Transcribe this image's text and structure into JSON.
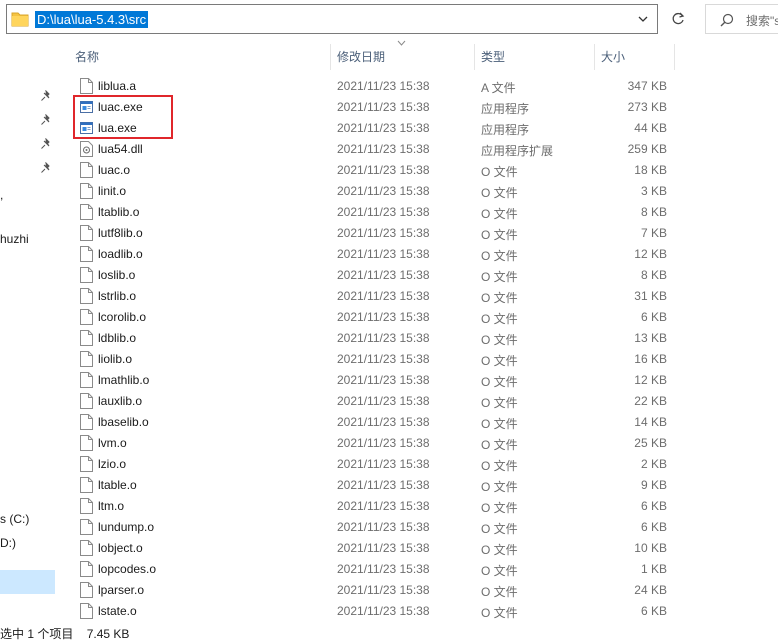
{
  "address": {
    "path": "D:\\lua\\lua-5.4.3\\src"
  },
  "search": {
    "placeholder": "搜索\"s"
  },
  "nav": {
    "items": [
      {
        "label": "huzhi",
        "pinned": false
      },
      {
        "label": "s (C:)",
        "pinned": false
      },
      {
        "label": "D:)",
        "pinned": false,
        "selected": true
      }
    ]
  },
  "columns": {
    "name": "名称",
    "date": "修改日期",
    "type": "类型",
    "size": "大小"
  },
  "files": [
    {
      "name": "liblua.a",
      "date": "2021/11/23 15:38",
      "type": "A 文件",
      "size": "347 KB",
      "icon": "file-icon"
    },
    {
      "name": "luac.exe",
      "date": "2021/11/23 15:38",
      "type": "应用程序",
      "size": "273 KB",
      "icon": "exe-icon"
    },
    {
      "name": "lua.exe",
      "date": "2021/11/23 15:38",
      "type": "应用程序",
      "size": "44 KB",
      "icon": "exe-icon"
    },
    {
      "name": "lua54.dll",
      "date": "2021/11/23 15:38",
      "type": "应用程序扩展",
      "size": "259 KB",
      "icon": "dll-icon"
    },
    {
      "name": "luac.o",
      "date": "2021/11/23 15:38",
      "type": "O 文件",
      "size": "18 KB",
      "icon": "file-icon"
    },
    {
      "name": "linit.o",
      "date": "2021/11/23 15:38",
      "type": "O 文件",
      "size": "3 KB",
      "icon": "file-icon"
    },
    {
      "name": "ltablib.o",
      "date": "2021/11/23 15:38",
      "type": "O 文件",
      "size": "8 KB",
      "icon": "file-icon"
    },
    {
      "name": "lutf8lib.o",
      "date": "2021/11/23 15:38",
      "type": "O 文件",
      "size": "7 KB",
      "icon": "file-icon"
    },
    {
      "name": "loadlib.o",
      "date": "2021/11/23 15:38",
      "type": "O 文件",
      "size": "12 KB",
      "icon": "file-icon"
    },
    {
      "name": "loslib.o",
      "date": "2021/11/23 15:38",
      "type": "O 文件",
      "size": "8 KB",
      "icon": "file-icon"
    },
    {
      "name": "lstrlib.o",
      "date": "2021/11/23 15:38",
      "type": "O 文件",
      "size": "31 KB",
      "icon": "file-icon"
    },
    {
      "name": "lcorolib.o",
      "date": "2021/11/23 15:38",
      "type": "O 文件",
      "size": "6 KB",
      "icon": "file-icon"
    },
    {
      "name": "ldblib.o",
      "date": "2021/11/23 15:38",
      "type": "O 文件",
      "size": "13 KB",
      "icon": "file-icon"
    },
    {
      "name": "liolib.o",
      "date": "2021/11/23 15:38",
      "type": "O 文件",
      "size": "16 KB",
      "icon": "file-icon"
    },
    {
      "name": "lmathlib.o",
      "date": "2021/11/23 15:38",
      "type": "O 文件",
      "size": "12 KB",
      "icon": "file-icon"
    },
    {
      "name": "lauxlib.o",
      "date": "2021/11/23 15:38",
      "type": "O 文件",
      "size": "22 KB",
      "icon": "file-icon"
    },
    {
      "name": "lbaselib.o",
      "date": "2021/11/23 15:38",
      "type": "O 文件",
      "size": "14 KB",
      "icon": "file-icon"
    },
    {
      "name": "lvm.o",
      "date": "2021/11/23 15:38",
      "type": "O 文件",
      "size": "25 KB",
      "icon": "file-icon"
    },
    {
      "name": "lzio.o",
      "date": "2021/11/23 15:38",
      "type": "O 文件",
      "size": "2 KB",
      "icon": "file-icon"
    },
    {
      "name": "ltable.o",
      "date": "2021/11/23 15:38",
      "type": "O 文件",
      "size": "9 KB",
      "icon": "file-icon"
    },
    {
      "name": "ltm.o",
      "date": "2021/11/23 15:38",
      "type": "O 文件",
      "size": "6 KB",
      "icon": "file-icon"
    },
    {
      "name": "lundump.o",
      "date": "2021/11/23 15:38",
      "type": "O 文件",
      "size": "6 KB",
      "icon": "file-icon"
    },
    {
      "name": "lobject.o",
      "date": "2021/11/23 15:38",
      "type": "O 文件",
      "size": "10 KB",
      "icon": "file-icon"
    },
    {
      "name": "lopcodes.o",
      "date": "2021/11/23 15:38",
      "type": "O 文件",
      "size": "1 KB",
      "icon": "file-icon"
    },
    {
      "name": "lparser.o",
      "date": "2021/11/23 15:38",
      "type": "O 文件",
      "size": "24 KB",
      "icon": "file-icon"
    },
    {
      "name": "lstate.o",
      "date": "2021/11/23 15:38",
      "type": "O 文件",
      "size": "6 KB",
      "icon": "file-icon"
    }
  ],
  "status": {
    "selection": "选中 1 个项目",
    "size": "7.45 KB"
  },
  "colors": {
    "selection_bg": "#0078d7",
    "highlight_border": "#e0262b",
    "nav_selected": "#cce8ff"
  }
}
